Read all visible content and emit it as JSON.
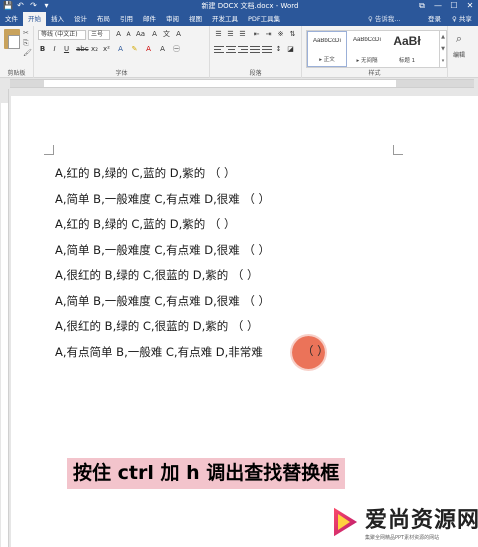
{
  "window": {
    "title": "新建 DOCX 文档.docx - Word",
    "controls": [
      "⧉",
      "—",
      "☐",
      "✕"
    ]
  },
  "qat": {
    "save": "💾",
    "undo": "↶",
    "redo": "↷",
    "more": "▾"
  },
  "tabs": [
    {
      "label": "文件"
    },
    {
      "label": "开始"
    },
    {
      "label": "插入"
    },
    {
      "label": "设计"
    },
    {
      "label": "布局"
    },
    {
      "label": "引用"
    },
    {
      "label": "邮件"
    },
    {
      "label": "审阅"
    },
    {
      "label": "视图"
    },
    {
      "label": "开发工具"
    },
    {
      "label": "PDF工具集"
    }
  ],
  "tell_me": "♀ 告诉我...",
  "login": "登录",
  "share": "♀ 共享",
  "ribbon": {
    "clipboard_label": "剪贴板",
    "font_name": "等线 (中文正)",
    "font_size": "三号",
    "font_label": "字体",
    "paragraph_label": "段落",
    "styles_label": "样式",
    "editing_label": "编辑",
    "styles": [
      {
        "sample": "AaBbCcDı",
        "name": "▸ 正文"
      },
      {
        "sample": "AaBbCcDı",
        "name": "▸ 无间隔"
      },
      {
        "sample": "AaBł",
        "name": "标题 1"
      }
    ]
  },
  "document": {
    "lines": [
      "A,红的  B,绿的  C,蓝的  D,紫的 （  ）",
      "A,简单  B,一般难度  C,有点难  D,很难 （  ）",
      "A,红的  B,绿的  C,蓝的  D,紫的 （  ）",
      "A,简单  B,一般难度  C,有点难  D,很难 （  ）",
      "A,很红的  B,绿的  C,很蓝的  D,紫的 （  ）",
      "A,简单  B,一般难度  C,有点难  D,很难 （  ）",
      "A,很红的  B,绿的  C,很蓝的  D,紫的 （  ）",
      "A,有点简单  B,一般难  C,有点难  D,非常难 "
    ],
    "last_paren": "（  ）"
  },
  "caption": "按住 ctrl 加 h 调出查找替换框",
  "watermark": {
    "title": "爱尚资源网",
    "subtitle": "集聚全网精品PPT素材资源的网站"
  },
  "colors": {
    "word_blue": "#2b579a",
    "caption_bg": "#f3c4cc",
    "cursor_dot": "#e85a3c"
  }
}
